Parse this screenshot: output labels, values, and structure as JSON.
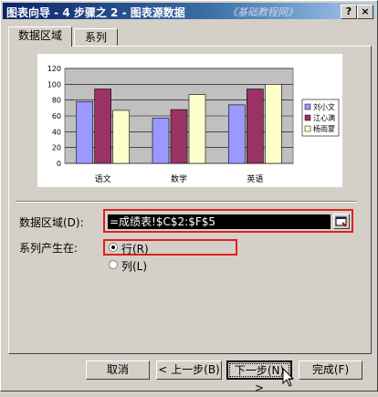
{
  "window": {
    "title": "图表向导 - 4 步骤之 2 - 图表源数据",
    "watermark": "《基础教程网》",
    "help_label": "?",
    "close_label": "×"
  },
  "tabs": [
    {
      "label": "数据区域",
      "active": true
    },
    {
      "label": "系列",
      "active": false
    }
  ],
  "chart_data": {
    "type": "bar",
    "categories": [
      "语文",
      "数学",
      "英语"
    ],
    "series": [
      {
        "name": "刘小文",
        "color": "#9999ff",
        "values": [
          78,
          57,
          74
        ]
      },
      {
        "name": "江心满",
        "color": "#993366",
        "values": [
          94,
          68,
          94
        ]
      },
      {
        "name": "杨雨蒙",
        "color": "#ffffcc",
        "values": [
          67,
          87,
          100
        ]
      }
    ],
    "ylim": [
      0,
      120
    ],
    "yticks": [
      0,
      20,
      40,
      60,
      80,
      100,
      120
    ],
    "plot_bg": "#c0c0c0",
    "grid": true,
    "legend": "right"
  },
  "form": {
    "range_label": "数据区域(D):",
    "range_value": "=成绩表!$C$2:$F$5",
    "series_in_label": "系列产生在:",
    "options": [
      {
        "label": "行(R)",
        "selected": true
      },
      {
        "label": "列(L)",
        "selected": false
      }
    ]
  },
  "buttons": {
    "cancel": "取消",
    "back": "< 上一步(B)",
    "next": "下一步(N) >",
    "finish": "完成(F)"
  }
}
